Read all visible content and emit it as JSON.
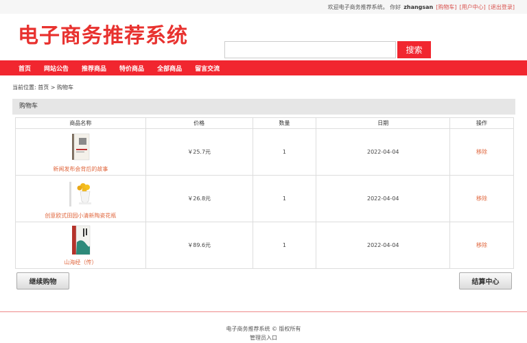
{
  "topbar": {
    "welcome": "欢迎电子商务推荐系统。 你好",
    "username": "zhangsan",
    "cart_link": "[购物车]",
    "user_center_link": "[用户中心]",
    "logout_link": "[退出登录]"
  },
  "header": {
    "logo": "电子商务推荐系统",
    "search_placeholder": "",
    "search_button": "搜索"
  },
  "nav": {
    "items": [
      "首页",
      "网站公告",
      "推荐商品",
      "特价商品",
      "全部商品",
      "留言交流"
    ]
  },
  "breadcrumb": {
    "prefix": "当前位置: 首页 >",
    "current": "购物车"
  },
  "panel": {
    "title": "购物车"
  },
  "table": {
    "headers": [
      "商品名称",
      "价格",
      "数量",
      "日期",
      "操作"
    ],
    "rows": [
      {
        "name": "新闻发布会背后的故事",
        "price": "￥25.7元",
        "qty": "1",
        "date": "2022-04-04",
        "action": "移除",
        "thumb": "book-icon"
      },
      {
        "name": "创意欧式田园小清新陶瓷花瓶",
        "price": "￥26.8元",
        "qty": "1",
        "date": "2022-04-04",
        "action": "移除",
        "thumb": "vase-icon"
      },
      {
        "name": "山海经（传）",
        "price": "￥89.6元",
        "qty": "1",
        "date": "2022-04-04",
        "action": "移除",
        "thumb": "book-cover-icon"
      }
    ]
  },
  "buttons": {
    "continue": "继续购物",
    "checkout": "结算中心"
  },
  "footer": {
    "copyright": "电子商务推荐系统 © 版权所有",
    "admin": "管理员入口"
  },
  "colors": {
    "accent": "#f1262f",
    "link": "#e0673e"
  }
}
